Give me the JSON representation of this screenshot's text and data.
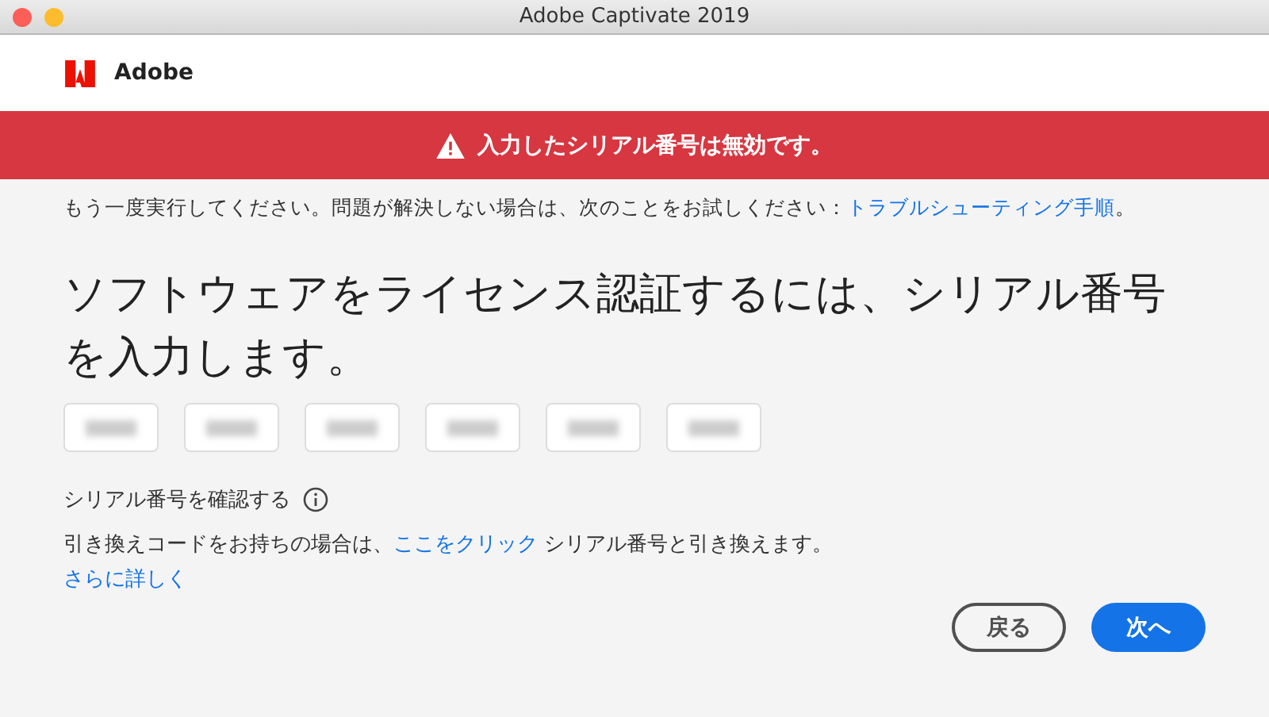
{
  "window": {
    "title": "Adobe Captivate 2019"
  },
  "header": {
    "logo_text": "Adobe"
  },
  "error_banner": {
    "message": "入力したシリアル番号は無効です。"
  },
  "help_line": {
    "text": "もう一度実行してください。問題が解決しない場合は、次のことをお試しください：",
    "link": "トラブルシューティング手順",
    "end": "。"
  },
  "heading": "ソフトウェアをライセンス認証するには、シリアル番号を入力します。",
  "serial_fields": [
    {
      "kind": "blurred"
    },
    {
      "kind": "blurred"
    },
    {
      "kind": "blurred"
    },
    {
      "kind": "blurred"
    },
    {
      "kind": "blurred"
    },
    {
      "kind": "blurred"
    }
  ],
  "verify_label": "シリアル番号を確認する",
  "redeem_line": {
    "before": "引き換えコードをお持ちの場合は、",
    "link": "ここをクリック",
    "after": " シリアル番号と引き換えます。"
  },
  "more_link": "さらに詳しく",
  "buttons": [
    {
      "label": "戻る",
      "kind": "secondary"
    },
    {
      "label": "次へ",
      "kind": "primary"
    }
  ]
}
